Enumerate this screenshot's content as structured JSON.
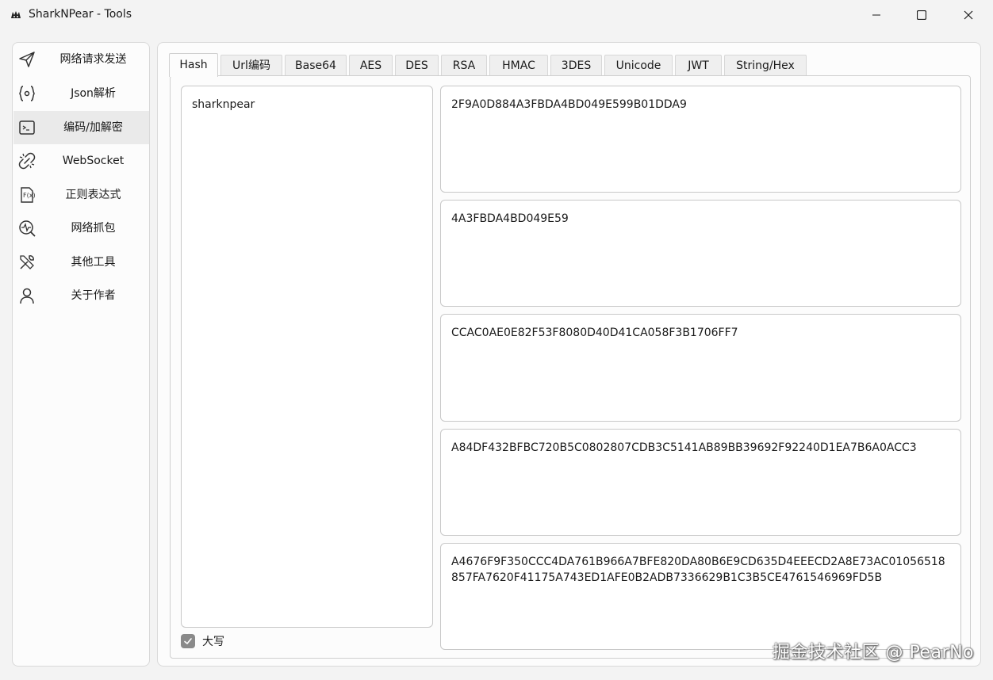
{
  "window": {
    "title": "SharkNPear - Tools",
    "icon": "shark-icon",
    "controls": [
      "minimize-icon",
      "maximize-icon",
      "close-icon"
    ]
  },
  "sidebar": {
    "items": [
      {
        "label": "网络请求发送",
        "icon": "send-icon",
        "active": false
      },
      {
        "label": "Json解析",
        "icon": "json-braces-icon",
        "active": false
      },
      {
        "label": "编码/加解密",
        "icon": "terminal-icon",
        "active": true
      },
      {
        "label": "WebSocket",
        "icon": "link-broken-icon",
        "active": false
      },
      {
        "label": "正则表达式",
        "icon": "regex-file-icon",
        "active": false
      },
      {
        "label": "网络抓包",
        "icon": "network-search-icon",
        "active": false
      },
      {
        "label": "其他工具",
        "icon": "tools-icon",
        "active": false
      },
      {
        "label": "关于作者",
        "icon": "person-icon",
        "active": false
      }
    ]
  },
  "tabs": {
    "items": [
      "Hash",
      "Url编码",
      "Base64",
      "AES",
      "DES",
      "RSA",
      "HMAC",
      "3DES",
      "Unicode",
      "JWT",
      "String/Hex"
    ],
    "selected": "Hash"
  },
  "hash": {
    "input": "sharknpear",
    "uppercase_label": "大写",
    "uppercase_checked": true,
    "outputs": [
      "2F9A0D884A3FBDA4BD049E599B01DDA9",
      "4A3FBDA4BD049E59",
      "CCAC0AE0E82F53F8080D40D41CA058F3B1706FF7",
      "A84DF432BFBC720B5C0802807CDB3C5141AB89BB39692F92240D1EA7B6A0ACC3",
      "A4676F9F350CCC4DA761B966A7BFE820DA80B6E9CD635D4EEECD2A8E73AC01056518857FA7620F41175A743ED1AFE0B2ADB7336629B1C3B5CE4761546969FD5B"
    ]
  },
  "watermark": "掘金技术社区 @ PearNo",
  "colors": {
    "window_bg": "#f3f3f3",
    "panel_bg": "#fcfcfc",
    "active_nav": "#eaeaea",
    "checkbox": "#8a8a8a"
  }
}
